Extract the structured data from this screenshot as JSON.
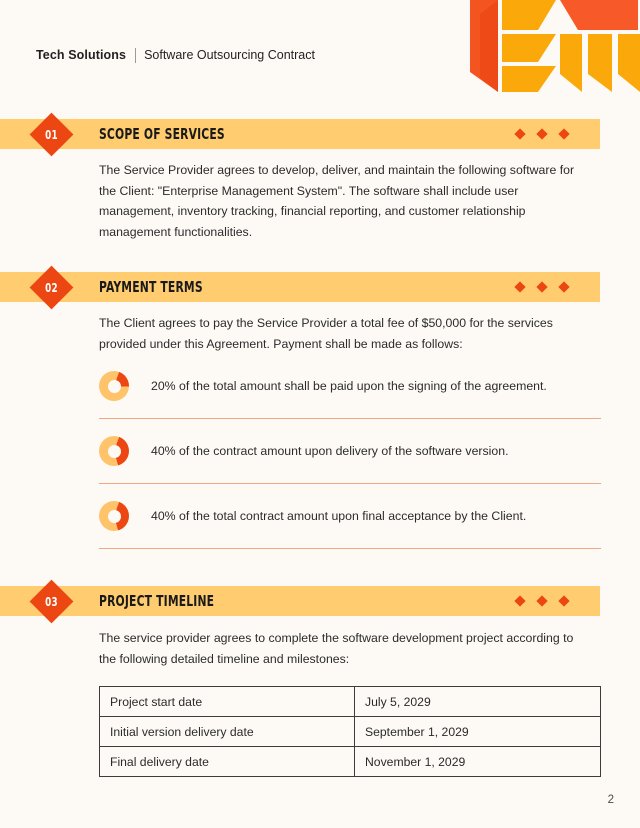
{
  "page": {
    "background_color": "#FDFAF5",
    "accent_orange": "#EC4712",
    "accent_amber": "#FFA500",
    "bar_color": "#FFCC70",
    "divider_color": "#F0A882",
    "page_number": "2"
  },
  "header": {
    "brand": "Tech Solutions",
    "subtitle": "Software Outsourcing Contract",
    "logo_icon": "geometric-em-monogram-icon"
  },
  "sections": [
    {
      "number": "01",
      "title": "Scope of Services",
      "paragraph": "The Service Provider agrees to develop, deliver, and maintain the following software for the Client: \"Enterprise Management System\". The software shall include user management, inventory tracking, financial reporting, and customer relationship management functionalities."
    },
    {
      "number": "02",
      "title": "Payment Terms",
      "paragraph": "The Client agrees to pay the Service Provider a total fee of $50,000 for the services provided under this Agreement. Payment shall be made as follows:",
      "payments": [
        {
          "percent": 20,
          "icon": "donut-chart-icon",
          "text": "20% of the total amount shall be paid upon the signing of the agreement."
        },
        {
          "percent": 40,
          "icon": "donut-chart-icon",
          "text": "40% of the contract amount upon delivery of the software version."
        },
        {
          "percent": 40,
          "icon": "donut-chart-icon",
          "text": "40% of the total contract amount upon final acceptance by the Client."
        }
      ]
    },
    {
      "number": "03",
      "title": "Project Timeline",
      "paragraph": "The service provider agrees to complete the software development project according to the following detailed timeline and milestones:",
      "table": {
        "rows": [
          {
            "label": "Project start date",
            "value": "July 5, 2029"
          },
          {
            "label": "Initial version delivery date",
            "value": "September 1, 2029"
          },
          {
            "label": "Final delivery date",
            "value": "November 1, 2029"
          }
        ]
      }
    }
  ],
  "decorations": {
    "bar_diamond_count": 3
  }
}
